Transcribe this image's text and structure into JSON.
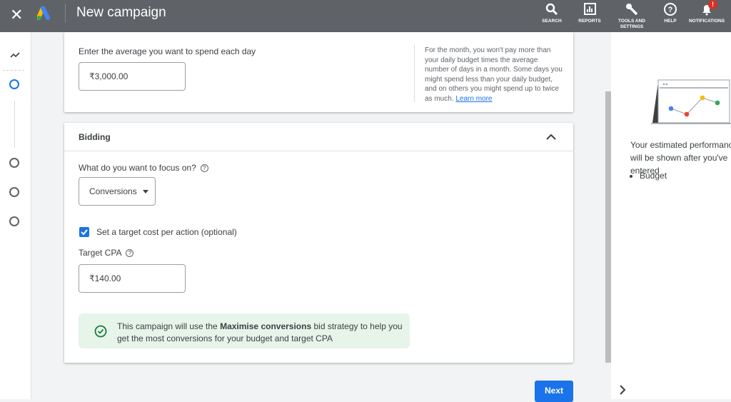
{
  "header": {
    "title": "New campaign",
    "actions": [
      {
        "label": "SEARCH",
        "icon": "search-icon"
      },
      {
        "label": "REPORTS",
        "icon": "reports-icon"
      },
      {
        "label": "TOOLS AND SETTINGS",
        "icon": "wrench-icon"
      },
      {
        "label": "HELP",
        "icon": "help-icon"
      },
      {
        "label": "NOTIFICATIONS",
        "icon": "bell-icon",
        "badge": "!"
      }
    ]
  },
  "budget": {
    "label": "Enter the average you want to spend each day",
    "value": "₹3,000.00",
    "info": "For the month, you won't pay more than your daily budget times the average number of days in a month. Some days you might spend less than your daily budget, and on others you might spend up to twice as much.",
    "learn_more": "Learn more"
  },
  "bidding": {
    "title": "Bidding",
    "focus_label": "What do you want to focus on?",
    "focus_value": "Conversions",
    "checkbox_label": "Set a target cost per action (optional)",
    "checkbox_checked": true,
    "cpa_label": "Target CPA",
    "cpa_value": "₹140.00",
    "notice_pre": "This campaign will use the ",
    "notice_bold": "Maximise conversions",
    "notice_post": " bid strategy to help you get the most conversions for your budget and target CPA"
  },
  "next_label": "Next",
  "right_panel": {
    "text": "Your estimated performance will be shown after you've entered",
    "bullets": [
      "Budget"
    ]
  },
  "colors": {
    "accent": "#1a73e8",
    "topbar": "#5f6368",
    "notice_bg": "#e6f4ea",
    "success": "#188038"
  }
}
